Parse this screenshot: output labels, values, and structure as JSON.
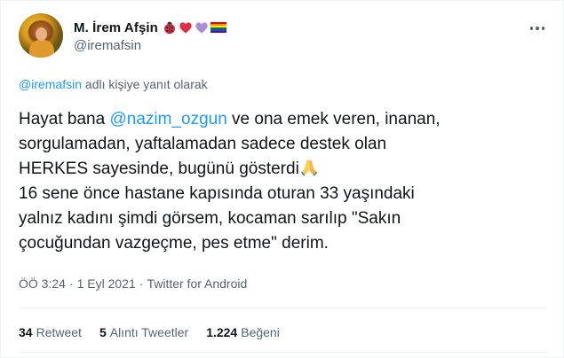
{
  "author": {
    "display_name": "M. İrem Afşin",
    "handle": "@iremafsin",
    "emoji_names": [
      "ladybug-emoji",
      "red-heart-emoji",
      "purple-heart-emoji",
      "rainbow-flag-emoji"
    ]
  },
  "reply_context": {
    "mention": "@iremafsin",
    "suffix": " adlı kişiye yanıt olarak"
  },
  "tweet": {
    "text_part1": "Hayat bana ",
    "mention": "@nazim_ozgun",
    "text_part2": " ve ona emek veren, inanan,\nsorgulamadan, yaftalamadan sadece destek olan\nHERKES sayesinde, bugünü gösterdi",
    "text_part3": "\n16 sene önce hastane kapısında oturan 33 yaşındaki\nyalnız kadını şimdi görsem, kocaman sarılıp \"Sakın\nçocuğundan vazgeçme, pes etme\" derim.",
    "emoji": "folded-hands-emoji"
  },
  "meta": {
    "time": "ÖÖ 3:24",
    "sep1": "·",
    "date": "1 Eyl 2021",
    "sep2": "·",
    "source": "Twitter for Android"
  },
  "stats": {
    "retweets": {
      "count": "34",
      "label": "Retweet"
    },
    "quotes": {
      "count": "5",
      "label": "Alıntı Tweetler"
    },
    "likes": {
      "count": "1.224",
      "label": "Beğeni"
    }
  },
  "colors": {
    "link": "#1d9bf0",
    "secondary_text": "#536471",
    "primary_text": "#0f1419",
    "divider": "#eff3f4"
  }
}
